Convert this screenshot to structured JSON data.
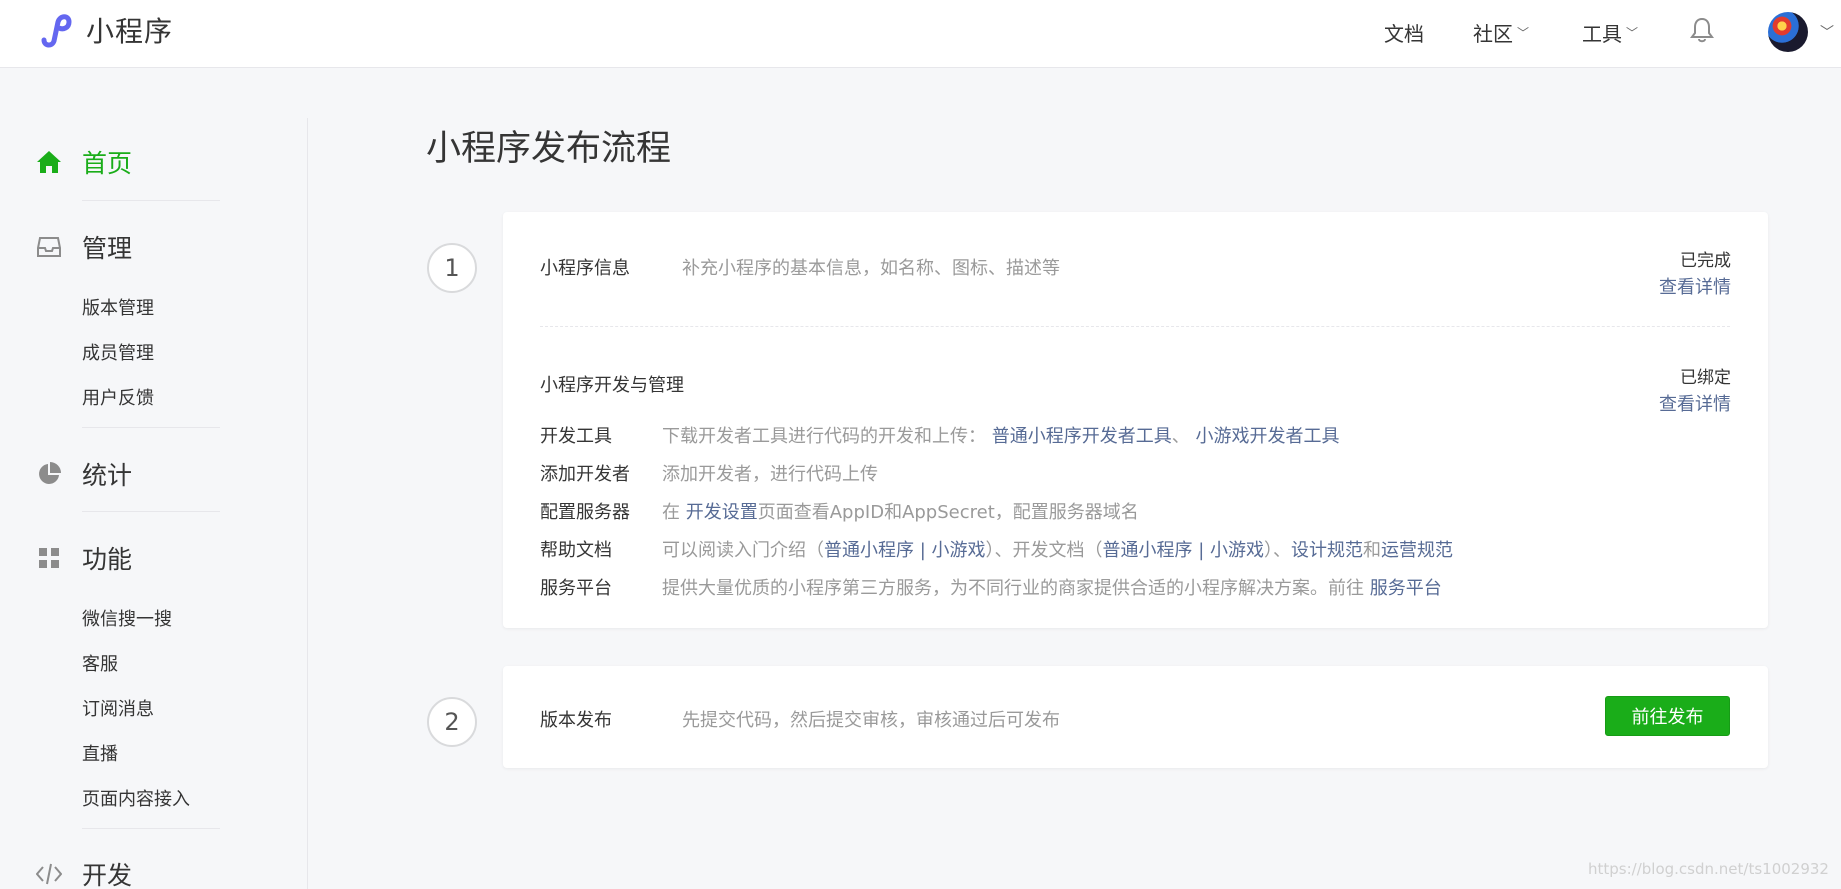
{
  "header": {
    "app_name": "小程序",
    "nav": [
      "文档",
      "社区",
      "工具"
    ],
    "icons": {
      "logo": "miniprogram-logo-icon",
      "bell": "bell-icon",
      "avatar": "user-avatar"
    }
  },
  "sidebar": {
    "sections": [
      {
        "label": "首页",
        "icon": "home-icon",
        "active": true
      },
      {
        "label": "管理",
        "icon": "inbox-icon"
      },
      {
        "label": "统计",
        "icon": "pie-chart-icon"
      },
      {
        "label": "功能",
        "icon": "grid-icon"
      },
      {
        "label": "开发",
        "icon": "code-icon"
      }
    ],
    "manage_items": [
      "版本管理",
      "成员管理",
      "用户反馈"
    ],
    "feature_items": [
      "微信搜一搜",
      "客服",
      "订阅消息",
      "直播",
      "页面内容接入"
    ]
  },
  "main": {
    "title": "小程序发布流程",
    "step1": {
      "number": "1",
      "info": {
        "name": "小程序信息",
        "desc": "补充小程序的基本信息，如名称、图标、描述等",
        "status": "已完成",
        "link": "查看详情"
      },
      "dev": {
        "name": "小程序开发与管理",
        "status": "已绑定",
        "link": "查看详情",
        "rows": {
          "tools": {
            "label": "开发工具",
            "text": "下载开发者工具进行代码的开发和上传：",
            "link1": "普通小程序开发者工具",
            "sep": "、",
            "link2": "小游戏开发者工具"
          },
          "developers": {
            "label": "添加开发者",
            "text": "添加开发者，进行代码上传"
          },
          "server": {
            "label": "配置服务器",
            "pre": "在",
            "link": "开发设置",
            "post": "页面查看AppID和AppSecret，配置服务器域名"
          },
          "docs": {
            "label": "帮助文档",
            "t1": "可以阅读入门介绍（",
            "l1": "普通小程序",
            "p1": " | ",
            "l2": "小游戏",
            "t2": "）、开发文档（",
            "l3": "普通小程序",
            "p2": " | ",
            "l4": "小游戏",
            "t3": "）、",
            "l5": "设计规范",
            "t4": "和",
            "l6": "运营规范"
          },
          "platform": {
            "label": "服务平台",
            "text": "提供大量优质的小程序第三方服务，为不同行业的商家提供合适的小程序解决方案。前往",
            "link": "服务平台"
          }
        }
      }
    },
    "step2": {
      "number": "2",
      "name": "版本发布",
      "desc": "先提交代码，然后提交审核，审核通过后可发布",
      "button": "前往发布"
    }
  },
  "watermark": "https://blog.csdn.net/ts1002932"
}
